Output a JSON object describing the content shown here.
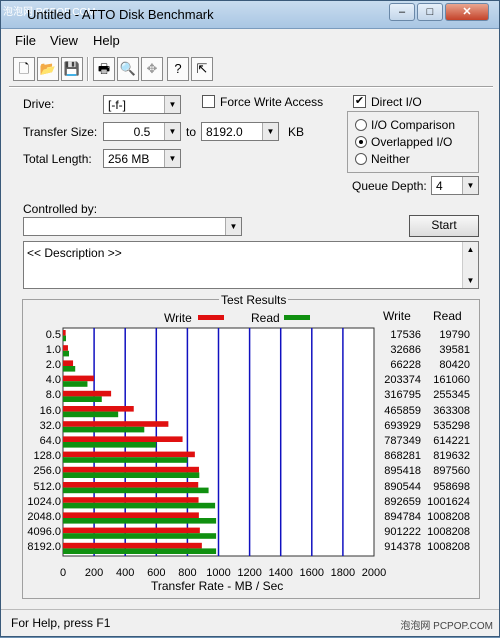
{
  "window": {
    "title": "Untitled - ATTO Disk Benchmark",
    "watermark_top": "泡泡网 PCPOP.COM",
    "minimize": "–",
    "maximize": "□",
    "close": "✕"
  },
  "menu": [
    {
      "label": "File"
    },
    {
      "label": "View"
    },
    {
      "label": "Help"
    }
  ],
  "toolbar": {
    "icons": [
      "new-file-icon",
      "open-folder-icon",
      "save-icon",
      "print-icon",
      "print-preview-icon",
      "move-icon",
      "help-icon",
      "context-help-icon"
    ]
  },
  "settings": {
    "drive_label": "Drive:",
    "drive_value": "[-f-]",
    "force_write_label": "Force Write Access",
    "direct_io_label": "Direct I/O",
    "transfer_size_label": "Transfer Size:",
    "transfer_from": "0.5",
    "to_label": "to",
    "transfer_to": "8192.0",
    "kb_label": "KB",
    "total_length_label": "Total Length:",
    "total_length_value": "256 MB",
    "io_comparison_label": "I/O Comparison",
    "overlapped_io_label": "Overlapped I/O",
    "neither_label": "Neither",
    "queue_depth_label": "Queue Depth:",
    "queue_depth_value": "4",
    "controlled_by_label": "Controlled by:",
    "controlled_by_value": "",
    "start_label": "Start",
    "description": "<< Description >>"
  },
  "results": {
    "title": "Test Results",
    "write_legend": "Write",
    "read_legend": "Read",
    "write_col": "Write",
    "read_col": "Read",
    "xlabel": "Transfer Rate - MB / Sec",
    "write_color": "#e01010",
    "read_color": "#109010",
    "grid_color": "#1010c0"
  },
  "chart_data": {
    "type": "bar",
    "title": "Test Results",
    "xlabel": "Transfer Rate - MB / Sec",
    "xlim": [
      0,
      2000
    ],
    "x_ticks": [
      "0",
      "200",
      "400",
      "600",
      "800",
      "1000",
      "1200",
      "1400",
      "1600",
      "1800",
      "2000"
    ],
    "categories": [
      "0.5",
      "1.0",
      "2.0",
      "4.0",
      "8.0",
      "16.0",
      "32.0",
      "64.0",
      "128.0",
      "256.0",
      "512.0",
      "1024.0",
      "2048.0",
      "4096.0",
      "8192.0"
    ],
    "series": [
      {
        "name": "Write",
        "values": [
          17536,
          32686,
          66228,
          203374,
          316795,
          465859,
          693929,
          787349,
          868281,
          895418,
          890544,
          892659,
          894784,
          901222,
          914378
        ]
      },
      {
        "name": "Read",
        "values": [
          19790,
          39581,
          80420,
          161060,
          255345,
          363308,
          535298,
          614221,
          819632,
          897560,
          958698,
          1001624,
          1008208,
          1008208,
          1008208
        ]
      }
    ]
  },
  "status": {
    "text": "For Help, press F1",
    "watermark": "泡泡网 PCPOP.COM"
  }
}
